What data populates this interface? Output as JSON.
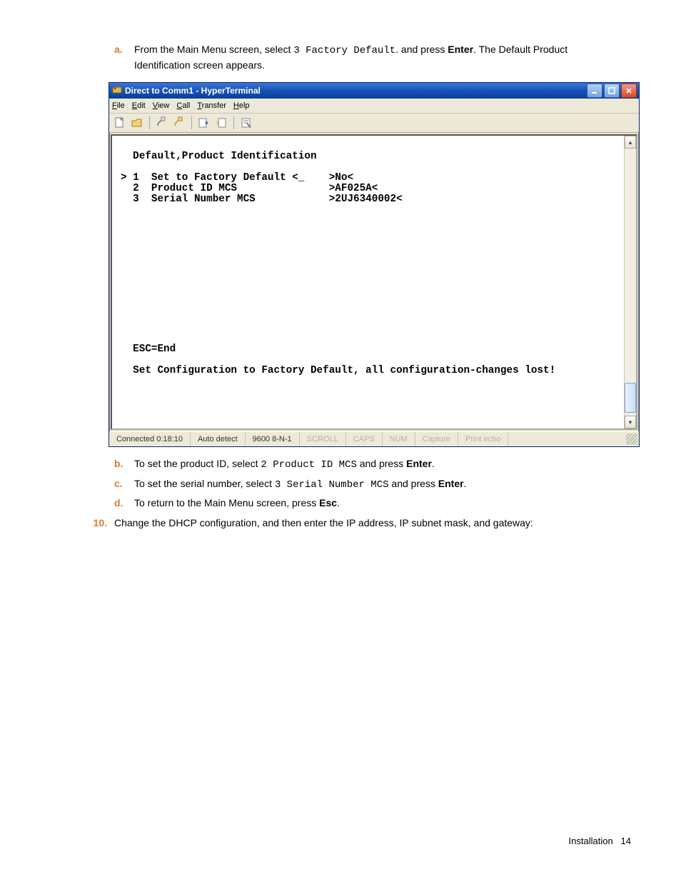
{
  "steps": {
    "a": {
      "marker": "a.",
      "pre": "From the Main Menu screen, select ",
      "code": "3 Factory Default",
      "mid": ". and press ",
      "key": "Enter",
      "post": ". The Default Product Identification screen appears."
    },
    "b": {
      "marker": "b.",
      "pre": "To set the product ID, select ",
      "code": "2 Product ID MCS",
      "mid": " and press ",
      "key": "Enter",
      "post": "."
    },
    "c": {
      "marker": "c.",
      "pre": "To set the serial number, select ",
      "code": "3 Serial Number MCS",
      "mid": " and press ",
      "key": "Enter",
      "post": "."
    },
    "d": {
      "marker": "d.",
      "pre": "To return to the Main Menu screen, press ",
      "key": "Esc",
      "post": "."
    },
    "ten": {
      "num": "10.",
      "text": "Change the DHCP configuration, and then enter the IP address, IP subnet mask, and gateway:"
    }
  },
  "window": {
    "title": "Direct to Comm1 - HyperTerminal",
    "menus": {
      "file": "File",
      "edit": "Edit",
      "view": "View",
      "call": "Call",
      "transfer": "Transfer",
      "help": "Help"
    },
    "terminal_lines": "  Default,Product Identification\n\n> 1  Set to Factory Default <_    >No<\n  2  Product ID MCS               >AF025A<\n  3  Serial Number MCS            >2UJ6340002<\n\n\n\n\n\n\n\n\n\n\n\n\n\n  ESC=End\n\n  Set Configuration to Factory Default, all configuration-changes lost!\n",
    "status": {
      "conn": "Connected 0:18:10",
      "autodetect": "Auto detect",
      "baud": "9600 8-N-1",
      "scroll": "SCROLL",
      "caps": "CAPS",
      "num": "NUM",
      "capture": "Capture",
      "printecho": "Print echo"
    }
  },
  "footer": {
    "label": "Installation",
    "page": "14"
  }
}
